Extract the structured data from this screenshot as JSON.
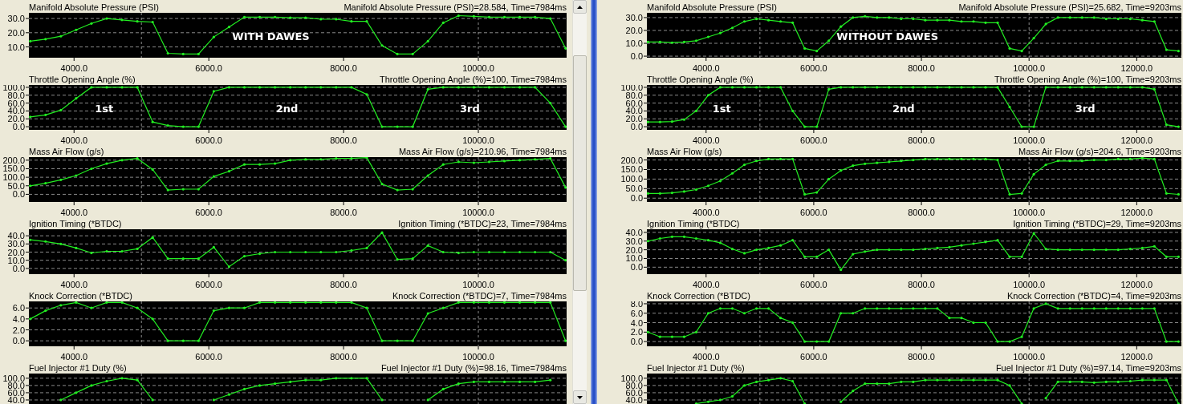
{
  "left_panel": {
    "charts": [
      {
        "reading": "Manifold Absolute Pressure (PSI)=28.584, Time=7984ms",
        "chart_data": {
          "type": "line",
          "title": "Manifold Absolute Pressure (PSI)",
          "grid": true,
          "x": [
            3350,
            3577,
            3804,
            4031,
            4258,
            4485,
            4712,
            4939,
            5166,
            5393,
            5620,
            5847,
            6074,
            6301,
            6528,
            6755,
            6982,
            7209,
            7436,
            7663,
            7890,
            8117,
            8344,
            8571,
            8798,
            9025,
            9252,
            9479,
            9706,
            9933,
            10160,
            10387,
            10614,
            10841,
            11068,
            11295
          ],
          "series": [
            {
              "color": "#22ee22",
              "values": [
                14,
                15.5,
                17.5,
                22,
                26.5,
                30,
                29,
                28,
                27.5,
                5.5,
                5,
                5,
                17,
                24,
                31,
                31,
                31,
                30.5,
                30.5,
                29.5,
                29.5,
                28,
                28,
                11,
                5,
                5,
                14,
                27,
                32,
                31.5,
                31,
                31,
                31,
                31,
                30,
                9
              ]
            }
          ],
          "xlim": [
            3330,
            11310
          ],
          "ylim": [
            2.4,
            34
          ],
          "xticks": [
            {
              "value": 4000,
              "label": "4000.0"
            },
            {
              "value": 6000,
              "label": "6000.0"
            },
            {
              "value": 8000,
              "label": "8000.0"
            },
            {
              "value": 10000,
              "label": "10000.0"
            }
          ],
          "yticks": [
            {
              "value": 10,
              "label": "10.0"
            },
            {
              "value": 20,
              "label": "20.0"
            },
            {
              "value": 30,
              "label": "30.0"
            }
          ],
          "annotations": [
            "WITH DAWES"
          ]
        }
      },
      {
        "reading": "Throttle Opening Angle (%)=100, Time=7984ms",
        "chart_data": {
          "type": "line",
          "title": "Throttle Opening Angle (%)",
          "grid": true,
          "x": [
            3350,
            3577,
            3804,
            4031,
            4258,
            4485,
            4712,
            4939,
            5166,
            5393,
            5620,
            5847,
            6074,
            6301,
            6528,
            6755,
            6982,
            7209,
            7436,
            7663,
            7890,
            8117,
            8344,
            8571,
            8798,
            9025,
            9252,
            9479,
            9706,
            9933,
            10160,
            10387,
            10614,
            10841,
            11068,
            11295
          ],
          "series": [
            {
              "color": "#22ee22",
              "values": [
                25,
                30,
                42,
                72,
                100,
                100,
                100,
                100,
                12,
                3,
                0,
                0,
                90,
                100,
                100,
                100,
                100,
                100,
                100,
                100,
                100,
                100,
                82,
                0,
                0,
                0,
                95,
                100,
                100,
                100,
                100,
                100,
                100,
                100,
                60,
                0
              ]
            }
          ],
          "xlim": [
            3330,
            11310
          ],
          "ylim": [
            -8,
            106
          ],
          "xticks": [
            {
              "value": 4000,
              "label": "4000.0"
            },
            {
              "value": 6000,
              "label": "6000.0"
            },
            {
              "value": 8000,
              "label": "8000.0"
            },
            {
              "value": 10000,
              "label": "10000.0"
            }
          ],
          "yticks": [
            {
              "value": 0,
              "label": "0.0"
            },
            {
              "value": 20,
              "label": "20.0"
            },
            {
              "value": 40,
              "label": "40.0"
            },
            {
              "value": 60,
              "label": "60.0"
            },
            {
              "value": 80,
              "label": "80.0"
            },
            {
              "value": 100,
              "label": "100.0"
            }
          ],
          "annotations": [
            "1st",
            "2nd",
            "3rd"
          ]
        }
      },
      {
        "reading": "Mass Air Flow (g/s)=210.96, Time=7984ms",
        "chart_data": {
          "type": "line",
          "title": "Mass Air Flow (g/s)",
          "grid": true,
          "x": [
            3350,
            3577,
            3804,
            4031,
            4258,
            4485,
            4712,
            4939,
            5166,
            5393,
            5620,
            5847,
            6074,
            6301,
            6528,
            6755,
            6982,
            7209,
            7436,
            7663,
            7890,
            8117,
            8344,
            8571,
            8798,
            9025,
            9252,
            9479,
            9706,
            9933,
            10160,
            10387,
            10614,
            10841,
            11068,
            11295
          ],
          "series": [
            {
              "color": "#22ee22",
              "values": [
                50,
                65,
                85,
                110,
                150,
                180,
                200,
                210,
                145,
                25,
                30,
                30,
                105,
                135,
                175,
                175,
                180,
                200,
                205,
                205,
                210,
                210,
                215,
                60,
                25,
                30,
                110,
                175,
                190,
                185,
                190,
                195,
                200,
                205,
                210,
                40
              ]
            }
          ],
          "xlim": [
            3330,
            11310
          ],
          "ylim": [
            -45,
            218
          ],
          "xticks": [
            {
              "value": 4000,
              "label": "4000.0"
            },
            {
              "value": 6000,
              "label": "6000.0"
            },
            {
              "value": 8000,
              "label": "8000.0"
            },
            {
              "value": 10000,
              "label": "10000.0"
            }
          ],
          "yticks": [
            {
              "value": 0,
              "label": "0.0"
            },
            {
              "value": 50,
              "label": "50.0"
            },
            {
              "value": 100,
              "label": "100.0"
            },
            {
              "value": 150,
              "label": "150.0"
            },
            {
              "value": 200,
              "label": "200.0"
            }
          ]
        }
      },
      {
        "reading": "Ignition Timing (*BTDC)=23, Time=7984ms",
        "chart_data": {
          "type": "line",
          "title": "Ignition Timing (*BTDC)",
          "grid": true,
          "x": [
            3350,
            3577,
            3804,
            4031,
            4258,
            4485,
            4712,
            4939,
            5166,
            5393,
            5620,
            5847,
            6074,
            6301,
            6528,
            6755,
            6982,
            7209,
            7436,
            7663,
            7890,
            8117,
            8344,
            8571,
            8798,
            9025,
            9252,
            9479,
            9706,
            9933,
            10160,
            10387,
            10614,
            10841,
            11068,
            11295
          ],
          "series": [
            {
              "color": "#22ee22",
              "values": [
                35,
                33,
                30,
                25,
                19,
                21,
                21,
                24,
                38,
                12,
                12,
                12,
                26,
                2,
                15,
                18,
                20,
                20,
                20,
                20,
                20,
                22,
                25,
                44,
                11,
                12,
                28,
                20,
                19,
                20,
                20,
                20,
                20,
                20,
                20,
                10
              ]
            }
          ],
          "xlim": [
            3330,
            11310
          ],
          "ylim": [
            -7,
            48
          ],
          "xticks": [
            {
              "value": 4000,
              "label": "4000.0"
            },
            {
              "value": 6000,
              "label": "6000.0"
            },
            {
              "value": 8000,
              "label": "8000.0"
            },
            {
              "value": 10000,
              "label": "10000.0"
            }
          ],
          "yticks": [
            {
              "value": 0,
              "label": "0.0"
            },
            {
              "value": 10,
              "label": "10.0"
            },
            {
              "value": 20,
              "label": "20.0"
            },
            {
              "value": 30,
              "label": "30.0"
            },
            {
              "value": 40,
              "label": "40.0"
            }
          ]
        }
      },
      {
        "reading": "Knock Correction (*BTDC)=7, Time=7984ms",
        "chart_data": {
          "type": "line",
          "title": "Knock Correction (*BTDC)",
          "grid": true,
          "x": [
            3350,
            3577,
            3804,
            4031,
            4258,
            4485,
            4712,
            4939,
            5166,
            5393,
            5620,
            5847,
            6074,
            6301,
            6528,
            6755,
            6982,
            7209,
            7436,
            7663,
            7890,
            8117,
            8344,
            8571,
            8798,
            9025,
            9252,
            9479,
            9706,
            9933,
            10160,
            10387,
            10614,
            10841,
            11068,
            11295
          ],
          "series": [
            {
              "color": "#22ee22",
              "values": [
                4,
                5.5,
                6.5,
                7,
                6,
                7,
                7,
                6,
                4,
                0,
                0,
                0,
                5.5,
                6,
                6,
                7,
                7,
                7,
                7,
                7,
                7,
                7,
                6,
                0,
                0,
                0,
                5,
                6,
                7,
                7,
                7,
                7,
                7,
                7,
                7,
                0
              ]
            }
          ],
          "xlim": [
            3330,
            11310
          ],
          "ylim": [
            -1,
            7.2
          ],
          "xticks": [
            {
              "value": 4000,
              "label": "4000.0"
            },
            {
              "value": 6000,
              "label": "6000.0"
            },
            {
              "value": 8000,
              "label": "8000.0"
            },
            {
              "value": 10000,
              "label": "10000.0"
            }
          ],
          "yticks": [
            {
              "value": 0,
              "label": "0.0"
            },
            {
              "value": 2,
              "label": "2.0"
            },
            {
              "value": 4,
              "label": "4.0"
            },
            {
              "value": 6,
              "label": "6.0"
            }
          ]
        }
      },
      {
        "reading": "Fuel Injector #1 Duty (%)=98.16, Time=7984ms",
        "chart_data": {
          "type": "line",
          "title": "Fuel Injector #1 Duty (%)",
          "grid": true,
          "x": [
            3804,
            4031,
            4258,
            4485,
            4712,
            4939,
            5166,
            6074,
            6301,
            6528,
            6755,
            6982,
            7209,
            7436,
            7663,
            7890,
            8117,
            8344,
            8571,
            9252,
            9479,
            9706,
            9933,
            10160,
            10387,
            10614,
            10841,
            11068
          ],
          "series": [
            {
              "color": "#22ee22",
              "values": [
                40,
                60,
                80,
                92,
                100,
                95,
                40,
                40,
                55,
                70,
                80,
                85,
                90,
                95,
                95,
                100,
                100,
                100,
                40,
                40,
                70,
                85,
                90,
                90,
                90,
                90,
                90,
                95
              ]
            }
          ],
          "xlim": [
            3330,
            11310
          ],
          "ylim": [
            -11,
            113
          ],
          "yticks": [
            {
              "value": 40,
              "label": "40.0"
            },
            {
              "value": 60,
              "label": "60.0"
            },
            {
              "value": 80,
              "label": "80.0"
            },
            {
              "value": 100,
              "label": "100.0"
            }
          ]
        }
      }
    ]
  },
  "right_panel": {
    "charts": [
      {
        "reading": "Manifold Absolute Pressure (PSI)=25.682, Time=9203ms",
        "chart_data": {
          "type": "line",
          "title": "Manifold Absolute Pressure (PSI)",
          "grid": true,
          "x": [
            2920,
            3144,
            3368,
            3592,
            3816,
            4040,
            4264,
            4488,
            4712,
            4936,
            5160,
            5384,
            5608,
            5832,
            6056,
            6280,
            6504,
            6728,
            6952,
            7176,
            7400,
            7624,
            7848,
            8072,
            8296,
            8520,
            8744,
            8968,
            9192,
            9416,
            9640,
            9864,
            10088,
            10312,
            10536,
            10760,
            10984,
            11208,
            11432,
            11656,
            11880,
            12104,
            12328,
            12552,
            12776
          ],
          "series": [
            {
              "color": "#22ee22",
              "values": [
                11,
                11,
                10.5,
                11,
                12,
                15,
                18,
                22,
                27,
                29,
                28,
                27,
                26,
                6,
                4,
                12,
                23,
                30,
                31,
                30,
                30,
                29,
                29,
                28,
                28,
                28,
                27,
                27,
                26,
                26,
                6,
                4,
                14,
                25,
                30,
                30,
                30,
                30,
                29,
                29,
                29,
                28,
                27,
                5,
                4
              ]
            }
          ],
          "xlim": [
            2900,
            12830
          ],
          "ylim": [
            -1.2,
            33.7
          ],
          "xticks": [
            {
              "value": 4000,
              "label": "4000.0"
            },
            {
              "value": 6000,
              "label": "6000.0"
            },
            {
              "value": 8000,
              "label": "8000.0"
            },
            {
              "value": 10000,
              "label": "10000.0"
            },
            {
              "value": 12000,
              "label": "12000.0"
            }
          ],
          "yticks": [
            {
              "value": 0,
              "label": "0.0"
            },
            {
              "value": 10,
              "label": "10.0"
            },
            {
              "value": 20,
              "label": "20.0"
            },
            {
              "value": 30,
              "label": "30.0"
            }
          ],
          "annotations": [
            "WITHOUT DAWES"
          ]
        }
      },
      {
        "reading": "Throttle Opening Angle (%)=100, Time=9203ms",
        "chart_data": {
          "type": "line",
          "title": "Throttle Opening Angle (%)",
          "grid": true,
          "x": [
            2920,
            3144,
            3368,
            3592,
            3816,
            4040,
            4264,
            4488,
            4712,
            4936,
            5160,
            5384,
            5608,
            5832,
            6056,
            6280,
            6504,
            6728,
            6952,
            7176,
            7400,
            7624,
            7848,
            8072,
            8296,
            8520,
            8744,
            8968,
            9192,
            9416,
            9640,
            9864,
            10088,
            10312,
            10536,
            10760,
            10984,
            11208,
            11432,
            11656,
            11880,
            12104,
            12328,
            12552,
            12776
          ],
          "series": [
            {
              "color": "#22ee22",
              "values": [
                12,
                12,
                13,
                18,
                40,
                80,
                100,
                100,
                100,
                100,
                100,
                100,
                40,
                0,
                0,
                95,
                100,
                100,
                100,
                100,
                100,
                100,
                100,
                100,
                100,
                100,
                100,
                100,
                100,
                100,
                50,
                0,
                0,
                100,
                100,
                100,
                100,
                100,
                100,
                100,
                100,
                100,
                95,
                5,
                0
              ]
            }
          ],
          "xlim": [
            2900,
            12830
          ],
          "ylim": [
            -8,
            106
          ],
          "xticks": [
            {
              "value": 4000,
              "label": "4000.0"
            },
            {
              "value": 6000,
              "label": "6000.0"
            },
            {
              "value": 8000,
              "label": "8000.0"
            },
            {
              "value": 10000,
              "label": "10000.0"
            },
            {
              "value": 12000,
              "label": "12000.0"
            }
          ],
          "yticks": [
            {
              "value": 0,
              "label": "0.0"
            },
            {
              "value": 20,
              "label": "20.0"
            },
            {
              "value": 40,
              "label": "40.0"
            },
            {
              "value": 60,
              "label": "60.0"
            },
            {
              "value": 80,
              "label": "80.0"
            },
            {
              "value": 100,
              "label": "100.0"
            }
          ],
          "annotations": [
            "1st",
            "2nd",
            "3rd"
          ]
        }
      },
      {
        "reading": "Mass Air Flow (g/s)=204.6, Time=9203ms",
        "chart_data": {
          "type": "line",
          "title": "Mass Air Flow (g/s)",
          "grid": true,
          "x": [
            2920,
            3144,
            3368,
            3592,
            3816,
            4040,
            4264,
            4488,
            4712,
            4936,
            5160,
            5384,
            5608,
            5832,
            6056,
            6280,
            6504,
            6728,
            6952,
            7176,
            7400,
            7624,
            7848,
            8072,
            8296,
            8520,
            8744,
            8968,
            9192,
            9416,
            9640,
            9864,
            10088,
            10312,
            10536,
            10760,
            10984,
            11208,
            11432,
            11656,
            11880,
            12104,
            12328,
            12552,
            12776
          ],
          "series": [
            {
              "color": "#22ee22",
              "values": [
                25,
                25,
                28,
                35,
                45,
                65,
                90,
                130,
                175,
                195,
                205,
                205,
                205,
                20,
                30,
                100,
                145,
                170,
                180,
                185,
                190,
                195,
                200,
                205,
                205,
                205,
                205,
                205,
                205,
                200,
                20,
                25,
                125,
                175,
                195,
                195,
                195,
                200,
                200,
                205,
                205,
                210,
                205,
                25,
                20
              ]
            }
          ],
          "xlim": [
            2900,
            12830
          ],
          "ylim": [
            -20,
            215
          ],
          "xticks": [
            {
              "value": 4000,
              "label": "4000.0"
            },
            {
              "value": 6000,
              "label": "6000.0"
            },
            {
              "value": 8000,
              "label": "8000.0"
            },
            {
              "value": 10000,
              "label": "10000.0"
            },
            {
              "value": 12000,
              "label": "12000.0"
            }
          ],
          "yticks": [
            {
              "value": 0,
              "label": "0.0"
            },
            {
              "value": 50,
              "label": "50.0"
            },
            {
              "value": 100,
              "label": "100.0"
            },
            {
              "value": 150,
              "label": "150.0"
            },
            {
              "value": 200,
              "label": "200.0"
            }
          ]
        }
      },
      {
        "reading": "Ignition Timing (*BTDC)=29, Time=9203ms",
        "chart_data": {
          "type": "line",
          "title": "Ignition Timing (*BTDC)",
          "grid": true,
          "x": [
            2920,
            3144,
            3368,
            3592,
            3816,
            4040,
            4264,
            4488,
            4712,
            4936,
            5160,
            5384,
            5608,
            5832,
            6056,
            6280,
            6504,
            6728,
            6952,
            7176,
            7400,
            7624,
            7848,
            8072,
            8296,
            8520,
            8744,
            8968,
            9192,
            9416,
            9640,
            9864,
            10088,
            10312,
            10536,
            10760,
            10984,
            11208,
            11432,
            11656,
            11880,
            12104,
            12328,
            12552,
            12776
          ],
          "series": [
            {
              "color": "#22ee22",
              "values": [
                30,
                33,
                35,
                35,
                33,
                31,
                28,
                21,
                16,
                20,
                22,
                25,
                31,
                12,
                12,
                20,
                -3,
                15,
                18,
                20,
                20,
                20,
                20,
                21,
                22,
                23,
                25,
                27,
                29,
                31,
                12,
                12,
                39,
                21,
                20,
                20,
                20,
                20,
                20,
                20,
                21,
                22,
                24,
                12,
                12
              ]
            }
          ],
          "xlim": [
            2900,
            12830
          ],
          "ylim": [
            -8,
            43.6
          ],
          "xticks": [
            {
              "value": 4000,
              "label": "4000.0"
            },
            {
              "value": 6000,
              "label": "6000.0"
            },
            {
              "value": 8000,
              "label": "8000.0"
            },
            {
              "value": 10000,
              "label": "10000.0"
            },
            {
              "value": 12000,
              "label": "12000.0"
            }
          ],
          "yticks": [
            {
              "value": 0,
              "label": "0.0"
            },
            {
              "value": 10,
              "label": "10.0"
            },
            {
              "value": 20,
              "label": "20.0"
            },
            {
              "value": 30,
              "label": "30.0"
            },
            {
              "value": 40,
              "label": "40.0"
            }
          ]
        }
      },
      {
        "reading": "Knock Correction (*BTDC)=4, Time=9203ms",
        "chart_data": {
          "type": "line",
          "title": "Knock Correction (*BTDC)",
          "grid": true,
          "x": [
            2920,
            3144,
            3368,
            3592,
            3816,
            4040,
            4264,
            4488,
            4712,
            4936,
            5160,
            5384,
            5608,
            5832,
            6056,
            6280,
            6504,
            6728,
            6952,
            7176,
            7400,
            7624,
            7848,
            8072,
            8296,
            8520,
            8744,
            8968,
            9192,
            9416,
            9640,
            9864,
            10088,
            10312,
            10536,
            10760,
            10984,
            11208,
            11432,
            11656,
            11880,
            12104,
            12328,
            12552,
            12776
          ],
          "series": [
            {
              "color": "#22ee22",
              "values": [
                2,
                1,
                1,
                1,
                2,
                6,
                7,
                7,
                6,
                7,
                7,
                5,
                4,
                0,
                0,
                0,
                6,
                6,
                7,
                7,
                7,
                7,
                7,
                7,
                7,
                5,
                5,
                4,
                4,
                0,
                0,
                1,
                7,
                8,
                7,
                7,
                7,
                7,
                7,
                7,
                7,
                7,
                7,
                0,
                0
              ]
            }
          ],
          "xlim": [
            2900,
            12830
          ],
          "ylim": [
            -1,
            8.5
          ],
          "xticks": [
            {
              "value": 4000,
              "label": "4000.0"
            },
            {
              "value": 6000,
              "label": "6000.0"
            },
            {
              "value": 8000,
              "label": "8000.0"
            },
            {
              "value": 10000,
              "label": "10000.0"
            },
            {
              "value": 12000,
              "label": "12000.0"
            }
          ],
          "yticks": [
            {
              "value": 0,
              "label": "0.0"
            },
            {
              "value": 2,
              "label": "2.0"
            },
            {
              "value": 4,
              "label": "4.0"
            },
            {
              "value": 6,
              "label": "6.0"
            },
            {
              "value": 8,
              "label": "8.0"
            }
          ]
        }
      },
      {
        "reading": "Fuel Injector #1 Duty (%)=97.14, Time=9203ms",
        "chart_data": {
          "type": "line",
          "title": "Fuel Injector #1 Duty (%)",
          "grid": true,
          "x": [
            3816,
            4040,
            4264,
            4488,
            4712,
            4936,
            5160,
            5384,
            5608,
            5832,
            6504,
            6728,
            6952,
            7176,
            7400,
            7624,
            7848,
            8072,
            8296,
            8520,
            8744,
            8968,
            9192,
            9416,
            9640,
            9864,
            10312,
            10536,
            10760,
            10984,
            11208,
            11432,
            11656,
            11880,
            12104,
            12328,
            12552,
            12776
          ],
          "series": [
            {
              "color": "#22ee22",
              "values": [
                30,
                35,
                40,
                50,
                80,
                90,
                95,
                100,
                92,
                30,
                35,
                65,
                85,
                85,
                85,
                90,
                90,
                95,
                95,
                95,
                95,
                95,
                95,
                95,
                80,
                30,
                45,
                90,
                90,
                90,
                88,
                90,
                90,
                92,
                95,
                95,
                95,
                30
              ]
            }
          ],
          "xlim": [
            2900,
            12830
          ],
          "ylim": [
            -11,
            113
          ],
          "yticks": [
            {
              "value": 40,
              "label": "40.0"
            },
            {
              "value": 60,
              "label": "60.0"
            },
            {
              "value": 80,
              "label": "80.0"
            },
            {
              "value": 100,
              "label": "100.0"
            }
          ]
        }
      }
    ]
  }
}
